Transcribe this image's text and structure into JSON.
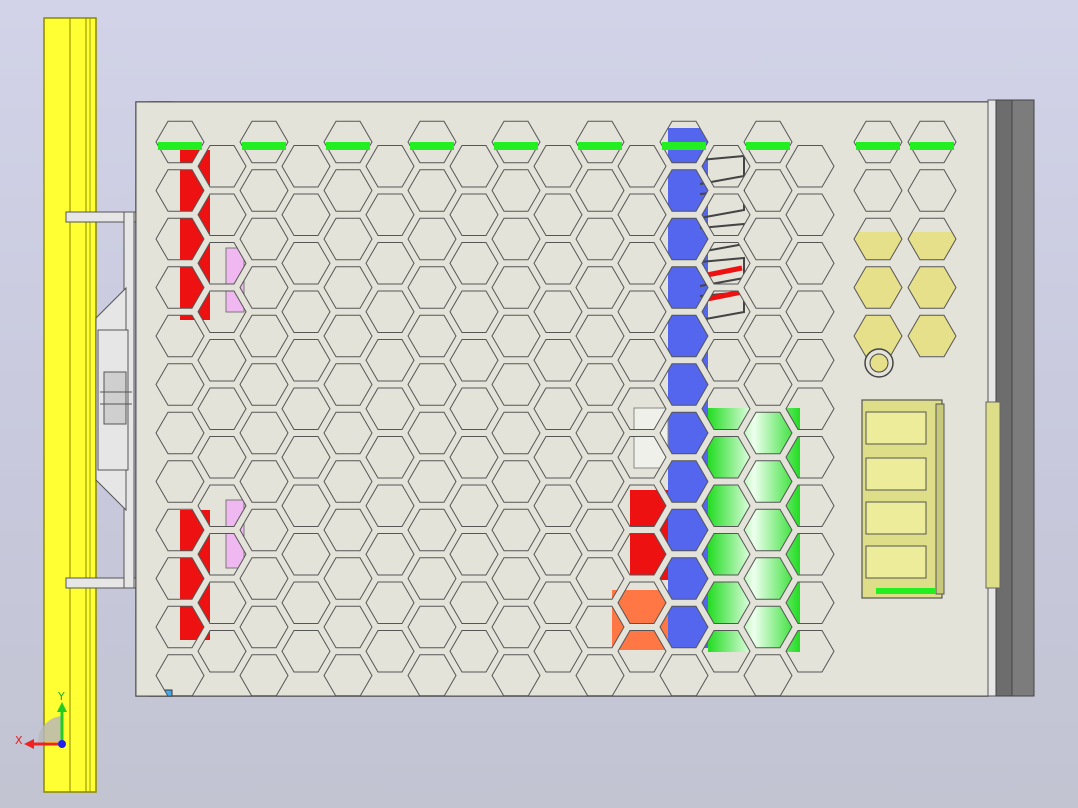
{
  "viewport": {
    "background_top": "#d2d3e8",
    "background_bottom": "#c2c4d2"
  },
  "colors": {
    "enclosure": "#e4e3da",
    "enclosure_edge": "#4a4a4a",
    "hole": "#cdcde3",
    "rail": "#ffff33",
    "rail_edge": "#8a8a00",
    "vent_stripe": "#22ee22",
    "component_red": "#ee1111",
    "component_blue": "#5566ee",
    "component_green": "#22ee22",
    "component_orange": "#ff7744",
    "component_pink": "#f0b8f0",
    "component_khaki": "#e6e08a",
    "terminal_block": "#dede88",
    "end_cap": "#777777",
    "corner_clip": "#44aaee"
  },
  "parts": {
    "din_rail": "din-rail",
    "mounting_clip": "mounting-clip",
    "enclosure": "power-supply-enclosure",
    "vent_grid": "hexagonal-vent-grid",
    "terminal_block": "terminal-block",
    "led_indicator": "led-indicator",
    "end_cap": "end-cap"
  },
  "triad": {
    "x_label": "X",
    "y_label": "Y",
    "x_color": "#ee2222",
    "y_color": "#22cc22",
    "z_color": "#2222ee"
  }
}
